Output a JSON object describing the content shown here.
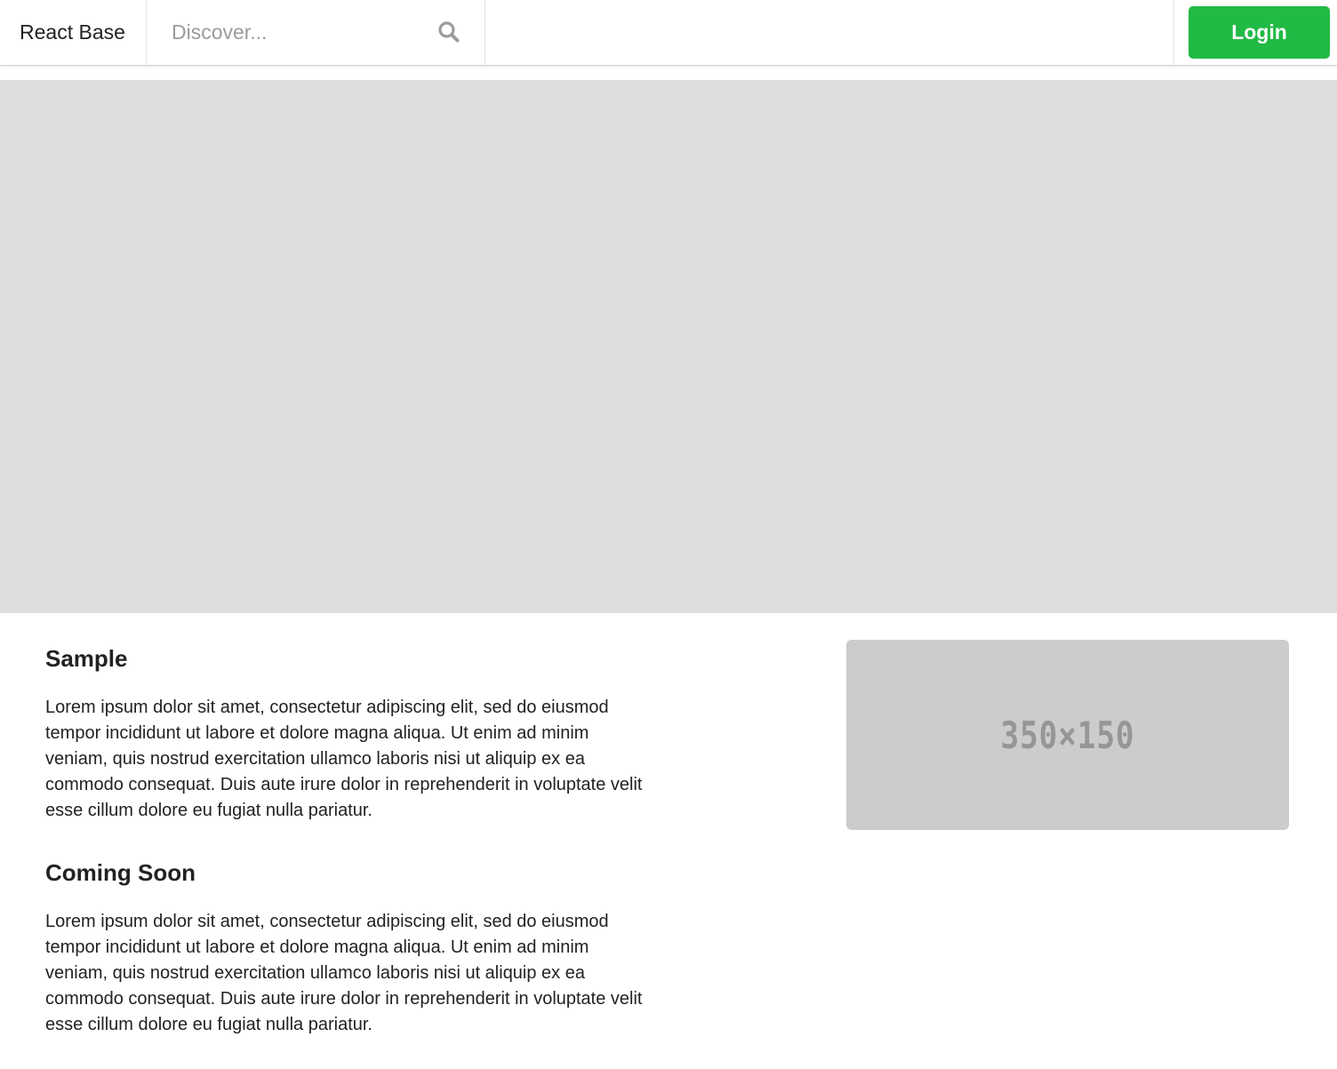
{
  "header": {
    "brand": "React Base",
    "search": {
      "placeholder": "Discover...",
      "value": "",
      "icon": "search-icon"
    },
    "login_label": "Login"
  },
  "colors": {
    "accent": "#21ba45",
    "hero_background": "#dedede",
    "thumbnail_background": "#cccccc"
  },
  "sections": [
    {
      "title": "Sample",
      "body": "Lorem ipsum dolor sit amet, consectetur adipiscing elit, sed do eiusmod tempor incididunt ut labore et dolore magna aliqua. Ut enim ad minim veniam, quis nostrud exercitation ullamco laboris nisi ut aliquip ex ea commodo consequat. Duis aute irure dolor in reprehenderit in voluptate velit esse cillum dolore eu fugiat nulla pariatur."
    },
    {
      "title": "Coming Soon",
      "body": "Lorem ipsum dolor sit amet, consectetur adipiscing elit, sed do eiusmod tempor incididunt ut labore et dolore magna aliqua. Ut enim ad minim veniam, quis nostrud exercitation ullamco laboris nisi ut aliquip ex ea commodo consequat. Duis aute irure dolor in reprehenderit in voluptate velit esse cillum dolore eu fugiat nulla pariatur."
    }
  ],
  "thumbnail": {
    "label": "350×150"
  }
}
